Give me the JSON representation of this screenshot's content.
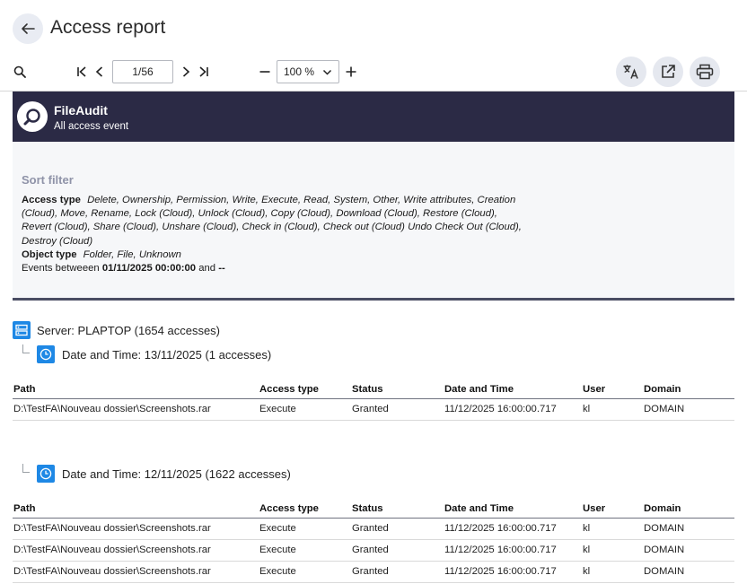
{
  "header": {
    "title": "Access report"
  },
  "toolbar": {
    "page_value": "1/56",
    "zoom_value": "100 %",
    "icons": [
      "search-icon",
      "first-page-icon",
      "prev-page-icon",
      "next-page-icon",
      "last-page-icon",
      "zoom-out-icon",
      "zoom-in-icon",
      "translate-icon",
      "open-external-icon",
      "print-icon"
    ]
  },
  "report": {
    "app_name": "FileAudit",
    "app_subtitle": "All access event",
    "filter": {
      "title": "Sort filter",
      "access_type_label": "Access type",
      "access_type_value": "Delete, Ownership, Permission, Write, Execute, Read, System, Other, Write attributes, Creation (Cloud), Move, Rename, Lock (Cloud), Unlock (Cloud), Copy (Cloud), Download (Cloud), Restore (Cloud), Revert (Cloud), Share (Cloud), Unshare (Cloud), Check in (Cloud), Check out (Cloud) Undo Check Out (Cloud), Destroy (Cloud)",
      "object_type_label": "Object type",
      "object_type_value": "Folder, File, Unknown",
      "events_prefix": "Events betweeen",
      "events_from": "01/11/2025 00:00:00",
      "events_and": "and",
      "events_to": "--"
    },
    "server_label": "Server: PLAPTOP (1654 accesses)",
    "columns": [
      "Path",
      "Access type",
      "Status",
      "Date and Time",
      "User",
      "Domain"
    ],
    "groups": [
      {
        "label": "Date and Time: 13/11/2025 (1 accesses)",
        "rows": [
          [
            "D:\\TestFA\\Nouveau dossier\\Screenshots.rar",
            "Execute",
            "Granted",
            "11/12/2025 16:00:00.717",
            "kl",
            "DOMAIN"
          ]
        ]
      },
      {
        "label": "Date and Time: 12/11/2025 (1622 accesses)",
        "rows": [
          [
            "D:\\TestFA\\Nouveau dossier\\Screenshots.rar",
            "Execute",
            "Granted",
            "11/12/2025 16:00:00.717",
            "kl",
            "DOMAIN"
          ],
          [
            "D:\\TestFA\\Nouveau dossier\\Screenshots.rar",
            "Execute",
            "Granted",
            "11/12/2025 16:00:00.717",
            "kl",
            "DOMAIN"
          ],
          [
            "D:\\TestFA\\Nouveau dossier\\Screenshots.rar",
            "Execute",
            "Granted",
            "11/12/2025 16:00:00.717",
            "kl",
            "DOMAIN"
          ]
        ]
      }
    ]
  }
}
